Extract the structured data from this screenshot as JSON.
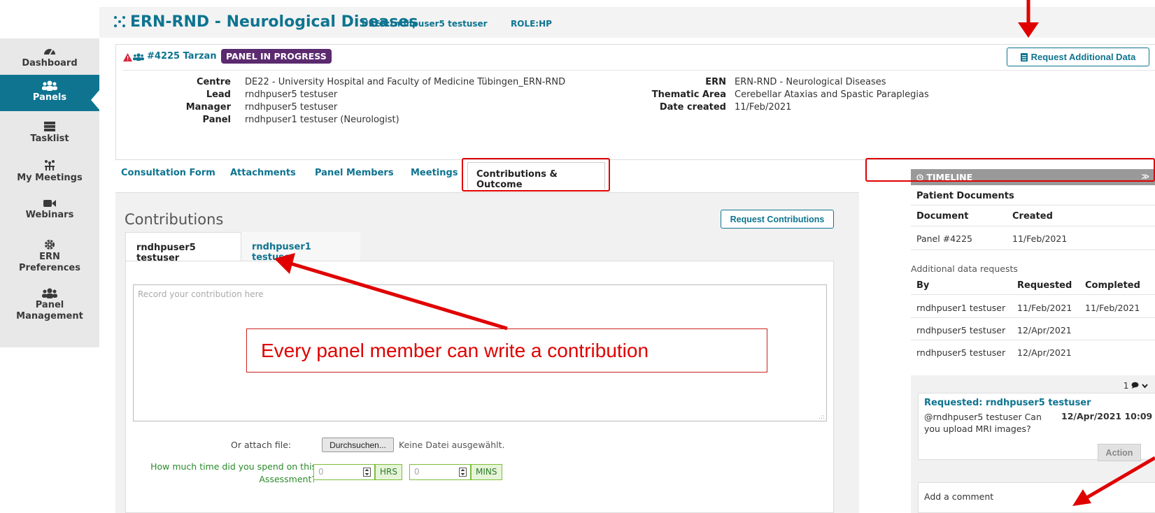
{
  "header": {
    "title": "ERN-RND - Neurological Diseases",
    "user_label": "USER:rndhpuser5 testuser",
    "role_label": "ROLE:HP"
  },
  "sidebar": {
    "items": [
      {
        "label": "Dashboard",
        "icon": "dashboard-icon"
      },
      {
        "label": "Panels",
        "icon": "group-icon",
        "active": true
      },
      {
        "label": "Tasklist",
        "icon": "server-list-icon"
      },
      {
        "label": "My Meetings",
        "icon": "meeting-icon"
      },
      {
        "label": "Webinars",
        "icon": "video-camera-icon"
      },
      {
        "label": "ERN Preferences",
        "line1": "ERN",
        "line2": "Preferences",
        "icon": "gear-icon"
      },
      {
        "label": "Panel Management",
        "line1": "Panel",
        "line2": "Management",
        "icon": "group-icon"
      }
    ]
  },
  "panel": {
    "id": "#4225 Tarzan",
    "status": "PANEL IN PROGRESS",
    "request_additional_label": "Request Additional Data",
    "details_left": [
      {
        "label": "Centre",
        "value": "DE22 - University Hospital and Faculty of Medicine Tübingen_ERN-RND"
      },
      {
        "label": "Lead",
        "value": "rndhpuser5 testuser"
      },
      {
        "label": "Manager",
        "value": "rndhpuser5 testuser"
      },
      {
        "label": "Panel",
        "value": "rndhpuser1 testuser (Neurologist)"
      }
    ],
    "details_right": [
      {
        "label": "ERN",
        "value": "ERN-RND - Neurological Diseases"
      },
      {
        "label": "Thematic Area",
        "value": "Cerebellar Ataxias and Spastic Paraplegias"
      },
      {
        "label": "Date created",
        "value": "11/Feb/2021"
      }
    ]
  },
  "tabs": [
    "Consultation Form",
    "Attachments",
    "Panel Members",
    "Meetings",
    "Contributions & Outcome"
  ],
  "contributions": {
    "title": "Contributions",
    "request_button": "Request Contributions",
    "member_tabs": [
      "rndhpuser5 testuser",
      "rndhpuser1 testuser"
    ],
    "placeholder": "Record your contribution here",
    "attach_label": "Or attach file:",
    "browse_label": "Durchsuchen...",
    "no_file_label": "Keine Datei ausgewählt.",
    "time_question": "How much time did you spend on this Assessment?",
    "hours_placeholder": "0",
    "hours_unit": "HRS",
    "mins_placeholder": "0",
    "mins_unit": "MINS"
  },
  "timeline": {
    "title": "TIMELINE",
    "patient_docs_title": "Patient Documents",
    "doc_headers": [
      "Document",
      "Created"
    ],
    "docs": [
      {
        "document": "Panel #4225",
        "created": "11/Feb/2021"
      }
    ],
    "additional_title": "Additional data requests",
    "req_headers": [
      "By",
      "Requested",
      "Completed"
    ],
    "requests": [
      {
        "by": "rndhpuser1 testuser",
        "requested": "11/Feb/2021",
        "completed": "11/Feb/2021"
      },
      {
        "by": "rndhpuser5 testuser",
        "requested": "12/Apr/2021",
        "completed": ""
      },
      {
        "by": "rndhpuser5 testuser",
        "requested": "12/Apr/2021",
        "completed": ""
      }
    ],
    "comment_count": "1",
    "comment": {
      "title": "Requested: rndhpuser5 testuser",
      "body": "@rndhpuser5 testuser Can you upload MRI images?",
      "timestamp": "12/Apr/2021 10:09",
      "action_label": "Action"
    },
    "add_comment_label": "Add a comment"
  },
  "annotation": {
    "callout_text": "Every panel member can write a contribution",
    "color": "#e00000"
  },
  "colors": {
    "brand": "#0e7490",
    "status_badge": "#5b2a6f",
    "sidebar_active": "#0e7490"
  }
}
